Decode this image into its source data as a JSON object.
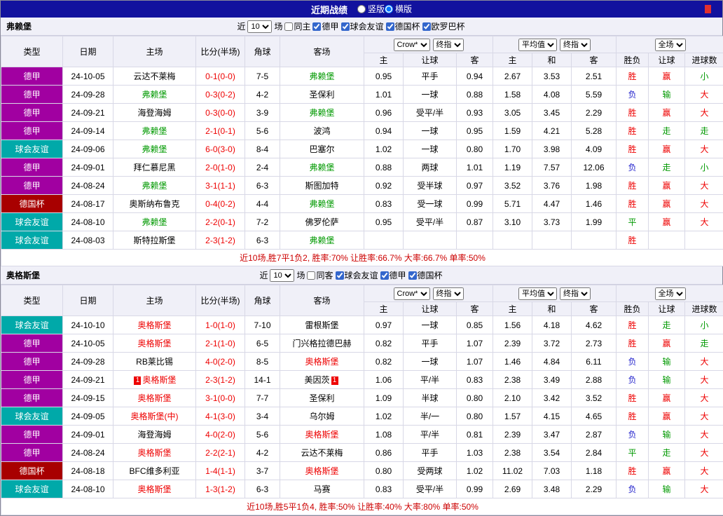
{
  "top_bar": {
    "title": "近期战绩",
    "options": [
      {
        "label": "竖版",
        "selected": false
      },
      {
        "label": "横版",
        "selected": true
      }
    ]
  },
  "league_colors": {
    "德甲": "#a100a1",
    "球会友谊": "#00a9a9",
    "德国杯": "#a80000"
  },
  "team_colors": {
    "normal": "#000000",
    "green": "#009900",
    "red": "#ee0000"
  },
  "score_color": "#ee0000",
  "result_colors": {
    "red": "#ee0000",
    "green": "#009900",
    "blue": "#2222cc"
  },
  "headers": {
    "left": [
      "类型",
      "日期",
      "主场",
      "比分(半场)",
      "角球",
      "客场"
    ],
    "asian": [
      "主",
      "让球",
      "客"
    ],
    "euro": [
      "主",
      "和",
      "客"
    ],
    "result": [
      "胜负",
      "让球",
      "进球数"
    ]
  },
  "sections": [
    {
      "title": "弗赖堡",
      "filter": {
        "prefix": "近",
        "count": "10",
        "suffix": "场",
        "same_label": "同主",
        "same_checked": false,
        "leagues": [
          {
            "label": "德甲",
            "checked": true
          },
          {
            "label": "球会友谊",
            "checked": true
          },
          {
            "label": "德国杯",
            "checked": true
          },
          {
            "label": "欧罗巴杯",
            "checked": true
          }
        ]
      },
      "dropdowns": {
        "asian": [
          "Crow*",
          "终指"
        ],
        "euro": [
          "平均值",
          "终指"
        ],
        "result": [
          "全场"
        ]
      },
      "rows": [
        {
          "league": "德甲",
          "date": "24-10-05",
          "home": {
            "name": "云达不莱梅",
            "color": "normal"
          },
          "score": "0-1(0-0)",
          "corner": "7-5",
          "away": {
            "name": "弗赖堡",
            "color": "green"
          },
          "odds": [
            "0.95",
            "平手",
            "0.94",
            "2.67",
            "3.53",
            "2.51"
          ],
          "results": [
            {
              "text": "胜",
              "color": "red"
            },
            {
              "text": "赢",
              "color": "red"
            },
            {
              "text": "小",
              "color": "green"
            }
          ]
        },
        {
          "league": "德甲",
          "date": "24-09-28",
          "home": {
            "name": "弗赖堡",
            "color": "green"
          },
          "score": "0-3(0-2)",
          "corner": "4-2",
          "away": {
            "name": "圣保利",
            "color": "normal"
          },
          "odds": [
            "1.01",
            "一球",
            "0.88",
            "1.58",
            "4.08",
            "5.59"
          ],
          "results": [
            {
              "text": "负",
              "color": "blue"
            },
            {
              "text": "输",
              "color": "green"
            },
            {
              "text": "大",
              "color": "red"
            }
          ]
        },
        {
          "league": "德甲",
          "date": "24-09-21",
          "home": {
            "name": "海登海姆",
            "color": "normal"
          },
          "score": "0-3(0-0)",
          "corner": "3-9",
          "away": {
            "name": "弗赖堡",
            "color": "green"
          },
          "odds": [
            "0.96",
            "受平/半",
            "0.93",
            "3.05",
            "3.45",
            "2.29"
          ],
          "results": [
            {
              "text": "胜",
              "color": "red"
            },
            {
              "text": "赢",
              "color": "red"
            },
            {
              "text": "大",
              "color": "red"
            }
          ]
        },
        {
          "league": "德甲",
          "date": "24-09-14",
          "home": {
            "name": "弗赖堡",
            "color": "green"
          },
          "score": "2-1(0-1)",
          "corner": "5-6",
          "away": {
            "name": "波鸿",
            "color": "normal"
          },
          "odds": [
            "0.94",
            "一球",
            "0.95",
            "1.59",
            "4.21",
            "5.28"
          ],
          "results": [
            {
              "text": "胜",
              "color": "red"
            },
            {
              "text": "走",
              "color": "green"
            },
            {
              "text": "走",
              "color": "green"
            }
          ]
        },
        {
          "league": "球会友谊",
          "date": "24-09-06",
          "home": {
            "name": "弗赖堡",
            "color": "green"
          },
          "score": "6-0(3-0)",
          "corner": "8-4",
          "away": {
            "name": "巴塞尔",
            "color": "normal"
          },
          "odds": [
            "1.02",
            "一球",
            "0.80",
            "1.70",
            "3.98",
            "4.09"
          ],
          "results": [
            {
              "text": "胜",
              "color": "red"
            },
            {
              "text": "赢",
              "color": "red"
            },
            {
              "text": "大",
              "color": "red"
            }
          ]
        },
        {
          "league": "德甲",
          "date": "24-09-01",
          "home": {
            "name": "拜仁慕尼黑",
            "color": "normal"
          },
          "score": "2-0(1-0)",
          "corner": "2-4",
          "away": {
            "name": "弗赖堡",
            "color": "green"
          },
          "odds": [
            "0.88",
            "两球",
            "1.01",
            "1.19",
            "7.57",
            "12.06"
          ],
          "results": [
            {
              "text": "负",
              "color": "blue"
            },
            {
              "text": "走",
              "color": "green"
            },
            {
              "text": "小",
              "color": "green"
            }
          ]
        },
        {
          "league": "德甲",
          "date": "24-08-24",
          "home": {
            "name": "弗赖堡",
            "color": "green"
          },
          "score": "3-1(1-1)",
          "corner": "6-3",
          "away": {
            "name": "斯图加特",
            "color": "normal"
          },
          "odds": [
            "0.92",
            "受半球",
            "0.97",
            "3.52",
            "3.76",
            "1.98"
          ],
          "results": [
            {
              "text": "胜",
              "color": "red"
            },
            {
              "text": "赢",
              "color": "red"
            },
            {
              "text": "大",
              "color": "red"
            }
          ]
        },
        {
          "league": "德国杯",
          "date": "24-08-17",
          "home": {
            "name": "奥斯纳布鲁克",
            "color": "normal"
          },
          "score": "0-4(0-2)",
          "corner": "4-4",
          "away": {
            "name": "弗赖堡",
            "color": "green"
          },
          "odds": [
            "0.83",
            "受一球",
            "0.99",
            "5.71",
            "4.47",
            "1.46"
          ],
          "results": [
            {
              "text": "胜",
              "color": "red"
            },
            {
              "text": "赢",
              "color": "red"
            },
            {
              "text": "大",
              "color": "red"
            }
          ]
        },
        {
          "league": "球会友谊",
          "date": "24-08-10",
          "home": {
            "name": "弗赖堡",
            "color": "green"
          },
          "score": "2-2(0-1)",
          "corner": "7-2",
          "away": {
            "name": "佛罗伦萨",
            "color": "normal"
          },
          "odds": [
            "0.95",
            "受平/半",
            "0.87",
            "3.10",
            "3.73",
            "1.99"
          ],
          "results": [
            {
              "text": "平",
              "color": "green"
            },
            {
              "text": "赢",
              "color": "red"
            },
            {
              "text": "大",
              "color": "red"
            }
          ]
        },
        {
          "league": "球会友谊",
          "date": "24-08-03",
          "home": {
            "name": "斯特拉斯堡",
            "color": "normal"
          },
          "score": "2-3(1-2)",
          "corner": "6-3",
          "away": {
            "name": "弗赖堡",
            "color": "green"
          },
          "odds": [
            "",
            "",
            "",
            "",
            "",
            ""
          ],
          "results": [
            {
              "text": "胜",
              "color": "red"
            },
            {
              "text": "",
              "color": "red"
            },
            {
              "text": "",
              "color": "red"
            }
          ]
        }
      ],
      "summary": "近10场,胜7平1负2, 胜率:70% 让胜率:66.7% 大率:66.7% 单率:50%"
    },
    {
      "title": "奥格斯堡",
      "filter": {
        "prefix": "近",
        "count": "10",
        "suffix": "场",
        "same_label": "同客",
        "same_checked": false,
        "leagues": [
          {
            "label": "球会友谊",
            "checked": true
          },
          {
            "label": "德甲",
            "checked": true
          },
          {
            "label": "德国杯",
            "checked": true
          }
        ]
      },
      "dropdowns": {
        "asian": [
          "Crow*",
          "终指"
        ],
        "euro": [
          "平均值",
          "终指"
        ],
        "result": [
          "全场"
        ]
      },
      "rows": [
        {
          "league": "球会友谊",
          "date": "24-10-10",
          "home": {
            "name": "奥格斯堡",
            "color": "red"
          },
          "score": "1-0(1-0)",
          "corner": "7-10",
          "away": {
            "name": "雷根斯堡",
            "color": "normal"
          },
          "odds": [
            "0.97",
            "一球",
            "0.85",
            "1.56",
            "4.18",
            "4.62"
          ],
          "results": [
            {
              "text": "胜",
              "color": "red"
            },
            {
              "text": "走",
              "color": "green"
            },
            {
              "text": "小",
              "color": "green"
            }
          ]
        },
        {
          "league": "德甲",
          "date": "24-10-05",
          "home": {
            "name": "奥格斯堡",
            "color": "red"
          },
          "score": "2-1(1-0)",
          "corner": "6-5",
          "away": {
            "name": "门兴格拉德巴赫",
            "color": "normal"
          },
          "odds": [
            "0.82",
            "平手",
            "1.07",
            "2.39",
            "3.72",
            "2.73"
          ],
          "results": [
            {
              "text": "胜",
              "color": "red"
            },
            {
              "text": "赢",
              "color": "red"
            },
            {
              "text": "走",
              "color": "green"
            }
          ]
        },
        {
          "league": "德甲",
          "date": "24-09-28",
          "home": {
            "name": "RB莱比锡",
            "color": "normal"
          },
          "score": "4-0(2-0)",
          "corner": "8-5",
          "away": {
            "name": "奥格斯堡",
            "color": "red"
          },
          "odds": [
            "0.82",
            "一球",
            "1.07",
            "1.46",
            "4.84",
            "6.11"
          ],
          "results": [
            {
              "text": "负",
              "color": "blue"
            },
            {
              "text": "输",
              "color": "green"
            },
            {
              "text": "大",
              "color": "red"
            }
          ]
        },
        {
          "league": "德甲",
          "date": "24-09-21",
          "home": {
            "name": "奥格斯堡",
            "color": "red",
            "badge": "1"
          },
          "score": "2-3(1-2)",
          "corner": "14-1",
          "away": {
            "name": "美因茨",
            "color": "normal",
            "badge": "1"
          },
          "odds": [
            "1.06",
            "平/半",
            "0.83",
            "2.38",
            "3.49",
            "2.88"
          ],
          "results": [
            {
              "text": "负",
              "color": "blue"
            },
            {
              "text": "输",
              "color": "green"
            },
            {
              "text": "大",
              "color": "red"
            }
          ]
        },
        {
          "league": "德甲",
          "date": "24-09-15",
          "home": {
            "name": "奥格斯堡",
            "color": "red"
          },
          "score": "3-1(0-0)",
          "corner": "7-7",
          "away": {
            "name": "圣保利",
            "color": "normal"
          },
          "odds": [
            "1.09",
            "半球",
            "0.80",
            "2.10",
            "3.42",
            "3.52"
          ],
          "results": [
            {
              "text": "胜",
              "color": "red"
            },
            {
              "text": "赢",
              "color": "red"
            },
            {
              "text": "大",
              "color": "red"
            }
          ]
        },
        {
          "league": "球会友谊",
          "date": "24-09-05",
          "home": {
            "name": "奥格斯堡(中)",
            "color": "red"
          },
          "score": "4-1(3-0)",
          "corner": "3-4",
          "away": {
            "name": "乌尔姆",
            "color": "normal"
          },
          "odds": [
            "1.02",
            "半/一",
            "0.80",
            "1.57",
            "4.15",
            "4.65"
          ],
          "results": [
            {
              "text": "胜",
              "color": "red"
            },
            {
              "text": "赢",
              "color": "red"
            },
            {
              "text": "大",
              "color": "red"
            }
          ]
        },
        {
          "league": "德甲",
          "date": "24-09-01",
          "home": {
            "name": "海登海姆",
            "color": "normal"
          },
          "score": "4-0(2-0)",
          "corner": "5-6",
          "away": {
            "name": "奥格斯堡",
            "color": "red"
          },
          "odds": [
            "1.08",
            "平/半",
            "0.81",
            "2.39",
            "3.47",
            "2.87"
          ],
          "results": [
            {
              "text": "负",
              "color": "blue"
            },
            {
              "text": "输",
              "color": "green"
            },
            {
              "text": "大",
              "color": "red"
            }
          ]
        },
        {
          "league": "德甲",
          "date": "24-08-24",
          "home": {
            "name": "奥格斯堡",
            "color": "red"
          },
          "score": "2-2(2-1)",
          "corner": "4-2",
          "away": {
            "name": "云达不莱梅",
            "color": "normal"
          },
          "odds": [
            "0.86",
            "平手",
            "1.03",
            "2.38",
            "3.54",
            "2.84"
          ],
          "results": [
            {
              "text": "平",
              "color": "green"
            },
            {
              "text": "走",
              "color": "green"
            },
            {
              "text": "大",
              "color": "red"
            }
          ]
        },
        {
          "league": "德国杯",
          "date": "24-08-18",
          "home": {
            "name": "BFC维多利亚",
            "color": "normal"
          },
          "score": "1-4(1-1)",
          "corner": "3-7",
          "away": {
            "name": "奥格斯堡",
            "color": "red"
          },
          "odds": [
            "0.80",
            "受两球",
            "1.02",
            "11.02",
            "7.03",
            "1.18"
          ],
          "results": [
            {
              "text": "胜",
              "color": "red"
            },
            {
              "text": "赢",
              "color": "red"
            },
            {
              "text": "大",
              "color": "red"
            }
          ]
        },
        {
          "league": "球会友谊",
          "date": "24-08-10",
          "home": {
            "name": "奥格斯堡",
            "color": "red"
          },
          "score": "1-3(1-2)",
          "corner": "6-3",
          "away": {
            "name": "马赛",
            "color": "normal"
          },
          "odds": [
            "0.83",
            "受平/半",
            "0.99",
            "2.69",
            "3.48",
            "2.29"
          ],
          "results": [
            {
              "text": "负",
              "color": "blue"
            },
            {
              "text": "输",
              "color": "green"
            },
            {
              "text": "大",
              "color": "red"
            }
          ]
        }
      ],
      "summary": "近10场,胜5平1负4, 胜率:50% 让胜率:40% 大率:80% 单率:50%"
    }
  ]
}
